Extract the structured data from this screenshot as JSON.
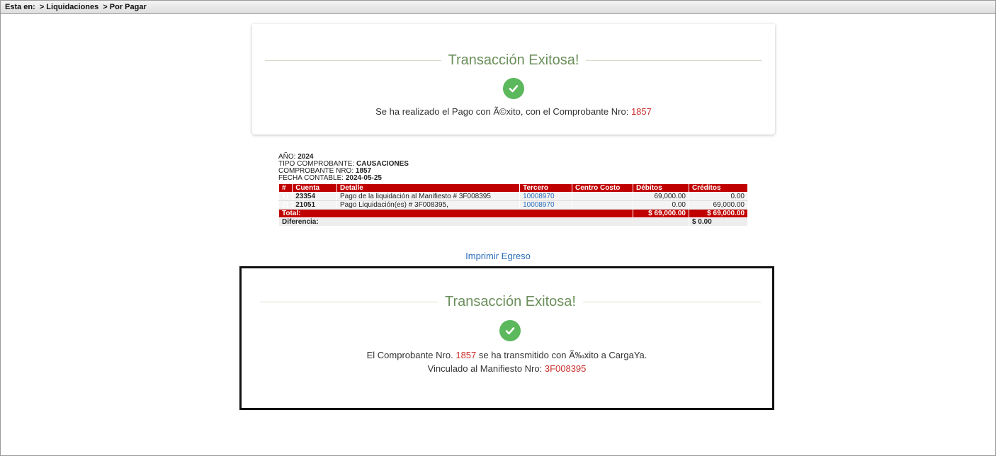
{
  "breadcrumb": {
    "prefix": "Esta en:",
    "items": [
      "Liquidaciones",
      "Por Pagar"
    ]
  },
  "payment_success": {
    "title": "Transacción Exitosa!",
    "message": "Se ha realizado el Pago con Ã©xito, con el Comprobante Nro:",
    "voucher_number": "1857"
  },
  "voucher": {
    "year_label": "AÑO:",
    "year": "2024",
    "type_label": "TIPO COMPROBANTE:",
    "type": "CAUSACIONES",
    "number_label": "COMPROBANTE NRO:",
    "number": "1857",
    "date_label": "FECHA CONTABLE:",
    "date": "2024-05-25",
    "columns": [
      "#",
      "Cuenta",
      "Detalle",
      "Tercero",
      "Centro Costo",
      "Débitos",
      "Créditos"
    ],
    "rows": [
      {
        "idx": "1)",
        "cuenta": "23354",
        "detalle": "Pago de la liquidación al Manifiesto # 3F008395",
        "tercero": "10008970",
        "centro": "",
        "debitos": "69,000.00",
        "creditos": "0.00"
      },
      {
        "idx": "2)",
        "cuenta": "21051",
        "detalle": "Pago Liquidación(es) # 3F008395,",
        "tercero": "10008970",
        "centro": "",
        "debitos": "0.00",
        "creditos": "69,000.00"
      }
    ],
    "total_label": "Total:",
    "total_debitos": "$ 69,000.00",
    "total_creditos": "$ 69,000.00",
    "diff_label": "Diferencia:",
    "diff_value": "$ 0.00"
  },
  "print_link": "Imprimir Egreso",
  "transmit_success": {
    "title": "Transacción Exitosa!",
    "msg_prefix": "El Comprobante Nro.",
    "voucher_number": "1857",
    "msg_suffix": "se ha transmitido con Ã‰xito a CargaYa.",
    "manifest_label": "Vinculado al Manifiesto Nro:",
    "manifest_number": "3F008395"
  },
  "colors": {
    "success_green": "#5cb85c",
    "title_green": "#6b8f5c",
    "table_header_red": "#c00000",
    "highlight_red": "#c9302c",
    "link_blue": "#2a6ebb"
  }
}
